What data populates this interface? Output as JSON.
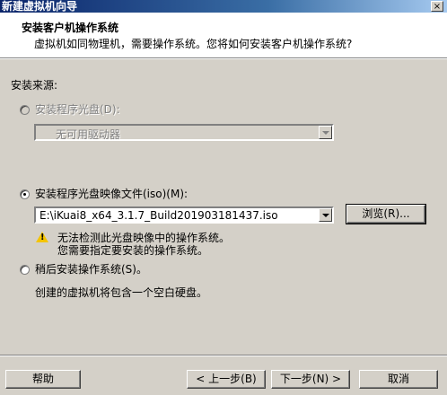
{
  "window": {
    "title": "新建虚拟机向导",
    "close_glyph": "×"
  },
  "header": {
    "title": "安装客户机操作系统",
    "subtitle": "虚拟机如同物理机，需要操作系统。您将如何安装客户机操作系统?"
  },
  "source_label": "安装来源:",
  "options": {
    "disc": {
      "label": "安装程序光盘(D):",
      "selected": false,
      "enabled": false,
      "drive_value": "无可用驱动器"
    },
    "iso": {
      "label": "安装程序光盘映像文件(iso)(M):",
      "selected": true,
      "enabled": true,
      "path_value": "E:\\iKuai8_x64_3.1.7_Build201903181437.iso",
      "browse_label": "浏览(R)..."
    },
    "warning": {
      "icon": "warning-icon",
      "line1": "无法检测此光盘映像中的操作系统。",
      "line2": "您需要指定要安装的操作系统。"
    },
    "later": {
      "label": "稍后安装操作系统(S)。",
      "selected": false,
      "enabled": true,
      "description": "创建的虚拟机将包含一个空白硬盘。"
    }
  },
  "buttons": {
    "help": "帮助",
    "back": "< 上一步(B)",
    "next": "下一步(N) >",
    "cancel": "取消"
  }
}
